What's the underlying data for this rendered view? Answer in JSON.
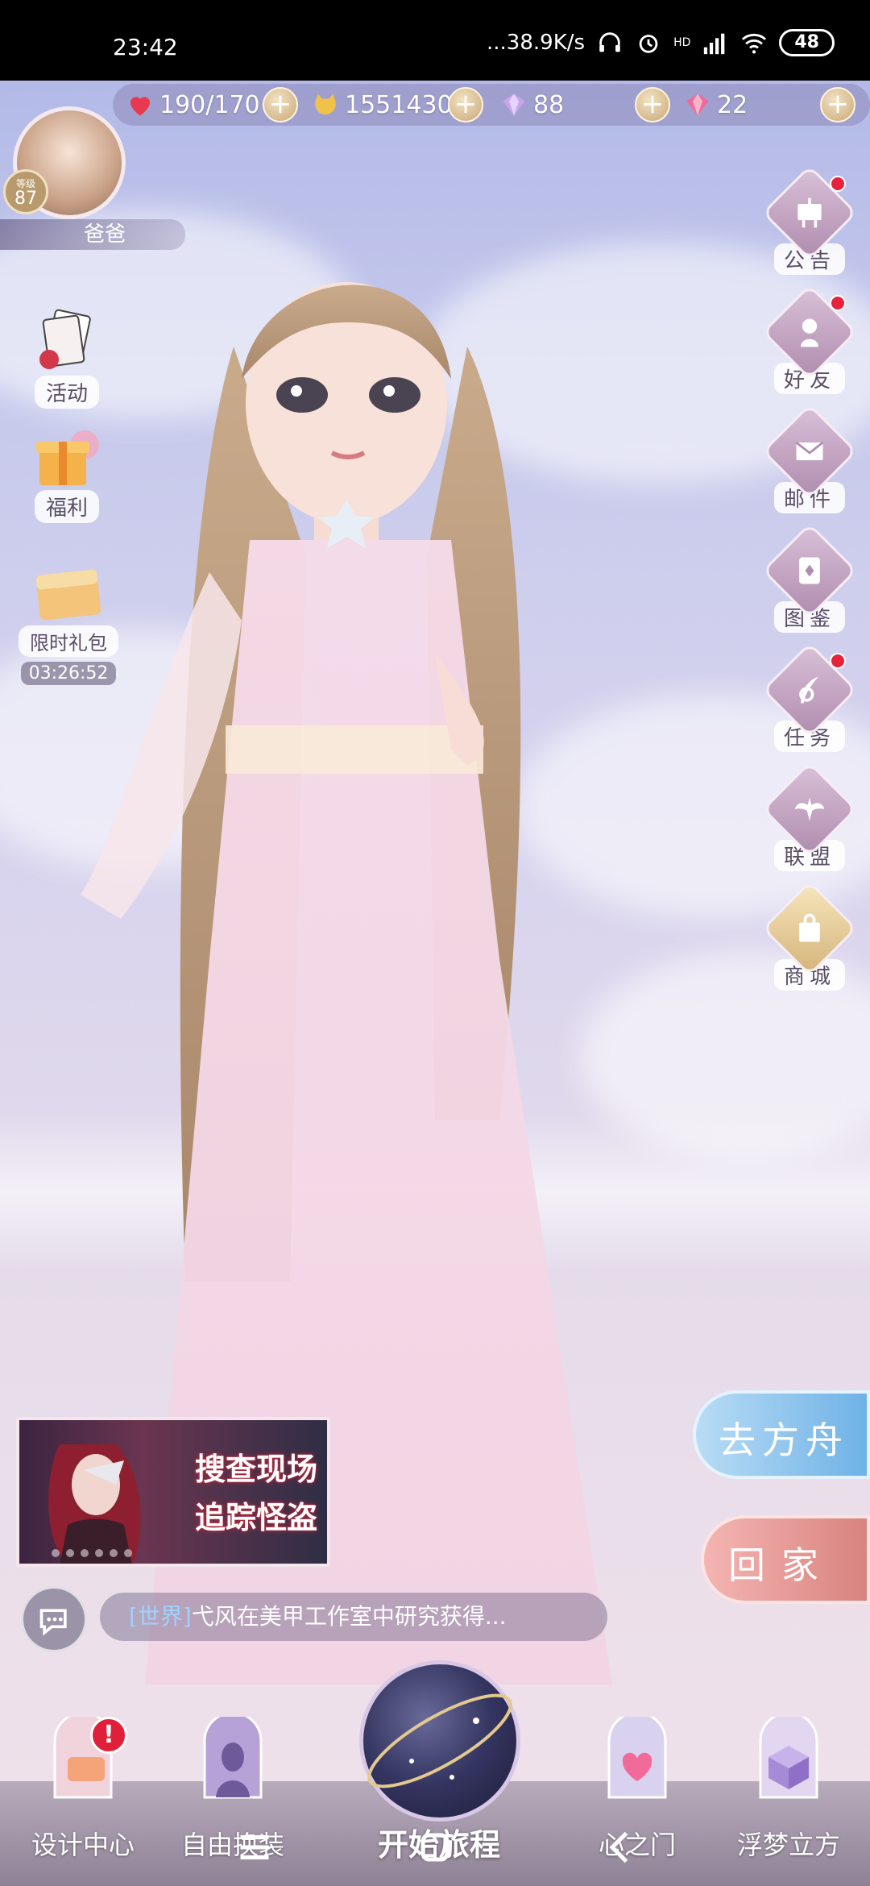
{
  "status_bar": {
    "time": "23:42",
    "network_speed": "...38.9K/s",
    "network_type": "HD",
    "battery": "48"
  },
  "resources": {
    "stamina": "190/170",
    "gold": "1551430",
    "diamonds": "88",
    "crystals": "22",
    "plus_label": "+"
  },
  "player": {
    "level_label": "等级",
    "level": "87",
    "name": "爸爸"
  },
  "left_menu": {
    "activity": "活动",
    "welfare": "福利",
    "limited_pack": "限时礼包",
    "limited_pack_timer": "03:26:52"
  },
  "right_menu": {
    "announcement": "公告",
    "friends": "好友",
    "mail": "邮件",
    "catalog": "图鉴",
    "tasks": "任务",
    "alliance": "联盟",
    "shop": "商城"
  },
  "banner": {
    "line1": "搜查现场",
    "line2": "追踪怪盗"
  },
  "actions": {
    "go_ark": "去方舟",
    "go_home": "回家"
  },
  "chat": {
    "channel": "[世界]",
    "message": "弋风在美甲工作室中研究获得..."
  },
  "bottom_nav": {
    "design_center": "设计中心",
    "free_dress": "自由换装",
    "start_journey": "开始旅程",
    "heart_gate": "心之门",
    "dream_cube": "浮梦立方",
    "alert_mark": "!"
  },
  "colors": {
    "red_dot": "#e8223c",
    "ark_blue": "#6fb2e6",
    "home_pink": "#d8837f"
  }
}
